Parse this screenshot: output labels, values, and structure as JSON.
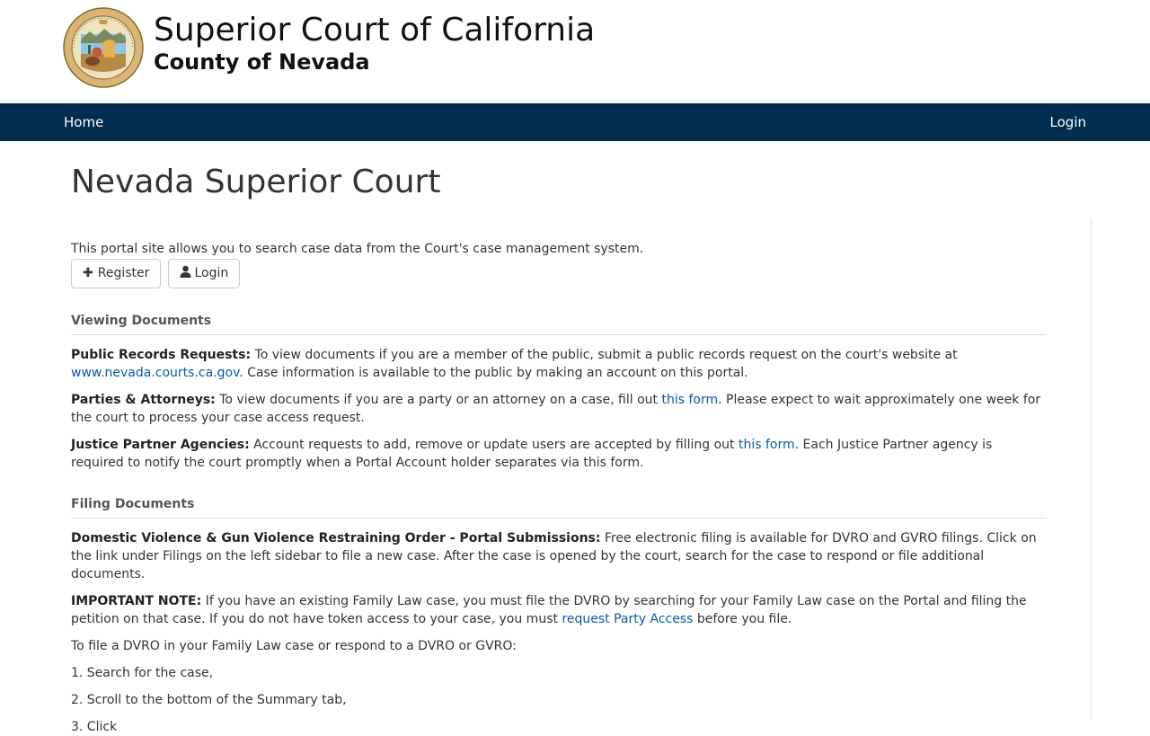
{
  "header": {
    "title": "Superior Court of California",
    "subtitle": "County of Nevada",
    "seal": {
      "name": "great-seal-of-california",
      "text_top": "THE GREAT SEAL OF THE STATE OF",
      "text_bottom": "CALIFORNIA",
      "motto": "EUREKA"
    }
  },
  "nav": {
    "home": "Home",
    "login": "Login"
  },
  "page": {
    "title": "Nevada Superior Court",
    "intro": "This portal site allows you to search case data from the Court's case management system.",
    "register_button": "Register",
    "login_button": "Login"
  },
  "viewing": {
    "heading": "Viewing Documents",
    "public_label": "Public Records Requests:",
    "public_text_1": "To view documents if you are a member of the public, submit a public records request on the court's website at",
    "public_link": "www.nevada.courts.ca.gov",
    "public_text_2": ". Case information is available to the public by making an account on this portal.",
    "parties_label": "Parties & Attorneys:",
    "parties_text_1": "To view documents if you are a party or an attorney on a case, fill out",
    "parties_link": "this form",
    "parties_text_2": ". Please expect to wait approximately one week for the court to process your case access request.",
    "justice_label": "Justice Partner Agencies:",
    "justice_text_1": "Account requests to add, remove or update users are accepted by filling out",
    "justice_link": "this form",
    "justice_text_2": ". Each Justice Partner agency is required to notify the court promptly when a Portal Account holder separates via this form."
  },
  "filing": {
    "heading": "Filing Documents",
    "dv_label": "Domestic Violence & Gun Violence Restraining Order - Portal Submissions:",
    "dv_text": "Free electronic filing is available for DVRO and GVRO filings. Click on the link under Filings on the left sidebar to file a new case. After the case is opened by the court, search for the case to respond or file additional documents.",
    "note_label": "IMPORTANT NOTE:",
    "note_text_1": "If you have an existing Family Law case, you must file the DVRO by searching for your Family Law case on the Portal and filing the petition on that case. If you do not have token access to your case, you must",
    "note_link": "request Party Access",
    "note_text_2": "before you file.",
    "howto": "To file a DVRO in your Family Law case or respond to a DVRO or GVRO:",
    "step1": "1. Search for the case,",
    "step2": "2. Scroll to the bottom of the Summary tab,",
    "step3": "3. Click"
  },
  "colors": {
    "navbar": "#002d52",
    "link": "#0a58a8",
    "text": "#333333"
  }
}
